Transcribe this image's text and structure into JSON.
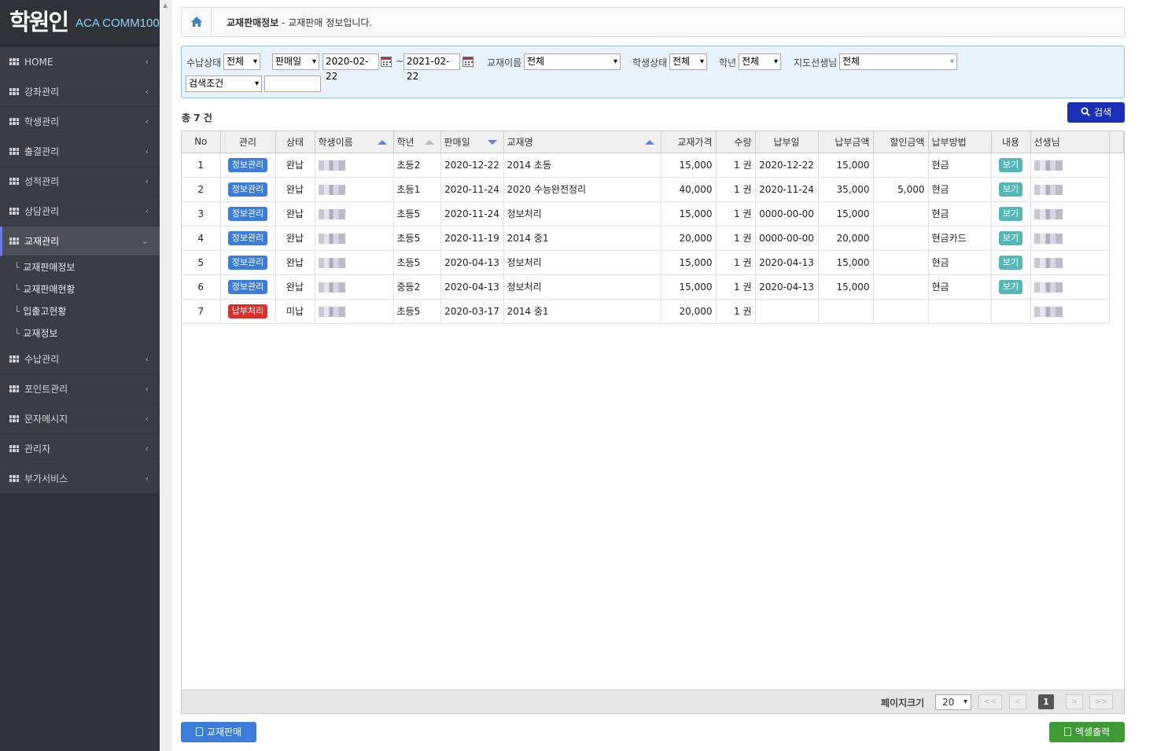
{
  "app": {
    "logo_mark": "학원인",
    "logo_text": "ACA COMM100"
  },
  "sidebar": {
    "items": [
      {
        "label": "HOME",
        "icon": "grid-icon"
      },
      {
        "label": "강좌관리",
        "icon": "grid-icon"
      },
      {
        "label": "학생관리",
        "icon": "grid-icon"
      },
      {
        "label": "출결관리",
        "icon": "grid-icon"
      },
      {
        "label": "성적관리",
        "icon": "grid-icon"
      },
      {
        "label": "상담관리",
        "icon": "grid-icon"
      },
      {
        "label": "교재관리",
        "icon": "grid-icon",
        "active": true
      },
      {
        "label": "수납관리",
        "icon": "grid-icon"
      },
      {
        "label": "포인트관리",
        "icon": "grid-icon"
      },
      {
        "label": "문자메시지",
        "icon": "grid-icon"
      },
      {
        "label": "관리자",
        "icon": "grid-icon"
      },
      {
        "label": "부가서비스",
        "icon": "grid-icon"
      }
    ],
    "submenu": [
      "교재판매정보",
      "교재판매현황",
      "입출고현황",
      "교재정보"
    ]
  },
  "breadcrumb": {
    "title": "교재판매정보",
    "separator": " - ",
    "description": "교재판매 정보입니다."
  },
  "filters": {
    "payment_status_label": "수납상태",
    "payment_status_value": "전체",
    "date_type_value": "판매일",
    "date_from": "2020-02-22",
    "date_tilde": "~",
    "date_to": "2021-02-22",
    "book_name_label": "교재이름",
    "book_name_value": "전체",
    "student_status_label": "학생상태",
    "student_status_value": "전체",
    "grade_label": "학년",
    "grade_value": "전체",
    "teacher_label": "지도선생님",
    "teacher_value": "전체",
    "search_condition_value": "검색조건",
    "search_text": ""
  },
  "search_button": "검색",
  "total_text": "총 7 건",
  "table": {
    "headers": [
      "No",
      "관리",
      "상태",
      "학생이름",
      "학년",
      "판매일",
      "교재명",
      "교재가격",
      "수량",
      "납부일",
      "납부금액",
      "할인금액",
      "납부방법",
      "내용",
      "선생님"
    ],
    "rows": [
      {
        "no": "1",
        "action": "정보관리",
        "action_type": "info",
        "status": "완납",
        "grade": "초등2",
        "sale_date": "2020-12-22",
        "book": "2014 초등",
        "price": "15,000",
        "qty": "1 권",
        "paid_date": "2020-12-22",
        "paid_amount": "15,000",
        "discount": "",
        "method": "현금",
        "view": "보기"
      },
      {
        "no": "2",
        "action": "정보관리",
        "action_type": "info",
        "status": "완납",
        "grade": "초등1",
        "sale_date": "2020-11-24",
        "book": "2020 수능완전정리",
        "price": "40,000",
        "qty": "1 권",
        "paid_date": "2020-11-24",
        "paid_amount": "35,000",
        "discount": "5,000",
        "method": "현금",
        "view": "보기"
      },
      {
        "no": "3",
        "action": "정보관리",
        "action_type": "info",
        "status": "완납",
        "grade": "초등5",
        "sale_date": "2020-11-24",
        "book": "정보처리",
        "price": "15,000",
        "qty": "1 권",
        "paid_date": "0000-00-00",
        "paid_amount": "15,000",
        "discount": "",
        "method": "현금",
        "view": "보기"
      },
      {
        "no": "4",
        "action": "정보관리",
        "action_type": "info",
        "status": "완납",
        "grade": "초등5",
        "sale_date": "2020-11-19",
        "book": "2014 중1",
        "price": "20,000",
        "qty": "1 권",
        "paid_date": "0000-00-00",
        "paid_amount": "20,000",
        "discount": "",
        "method": "현금카드",
        "view": "보기"
      },
      {
        "no": "5",
        "action": "정보관리",
        "action_type": "info",
        "status": "완납",
        "grade": "초등5",
        "sale_date": "2020-04-13",
        "book": "정보처리",
        "price": "15,000",
        "qty": "1 권",
        "paid_date": "2020-04-13",
        "paid_amount": "15,000",
        "discount": "",
        "method": "현금",
        "view": "보기"
      },
      {
        "no": "6",
        "action": "정보관리",
        "action_type": "info",
        "status": "완납",
        "grade": "중등2",
        "sale_date": "2020-04-13",
        "book": "정보처리",
        "price": "15,000",
        "qty": "1 권",
        "paid_date": "2020-04-13",
        "paid_amount": "15,000",
        "discount": "",
        "method": "현금",
        "view": "보기"
      },
      {
        "no": "7",
        "action": "납부처리",
        "action_type": "pay",
        "status": "미납",
        "grade": "초등5",
        "sale_date": "2020-03-17",
        "book": "2014 중1",
        "price": "20,000",
        "qty": "1 권",
        "paid_date": "",
        "paid_amount": "",
        "discount": "",
        "method": "",
        "view": ""
      }
    ]
  },
  "pager": {
    "page_size_label": "페이지크기",
    "page_size_value": "20",
    "first": "<<",
    "prev": "<",
    "current_page": "1",
    "next": ">",
    "last": ">>"
  },
  "bottom": {
    "sell_button": "교재판매",
    "excel_button": "엑셀출력"
  },
  "colors": {
    "sidebar_bg": "#2f3237",
    "accent_blue": "#1a2fb8",
    "info_button": "#3b7dd8",
    "pay_button": "#d9302c",
    "view_button": "#55b7b8",
    "excel_button": "#3e9a35",
    "filter_bg": "#e8f3fb"
  }
}
